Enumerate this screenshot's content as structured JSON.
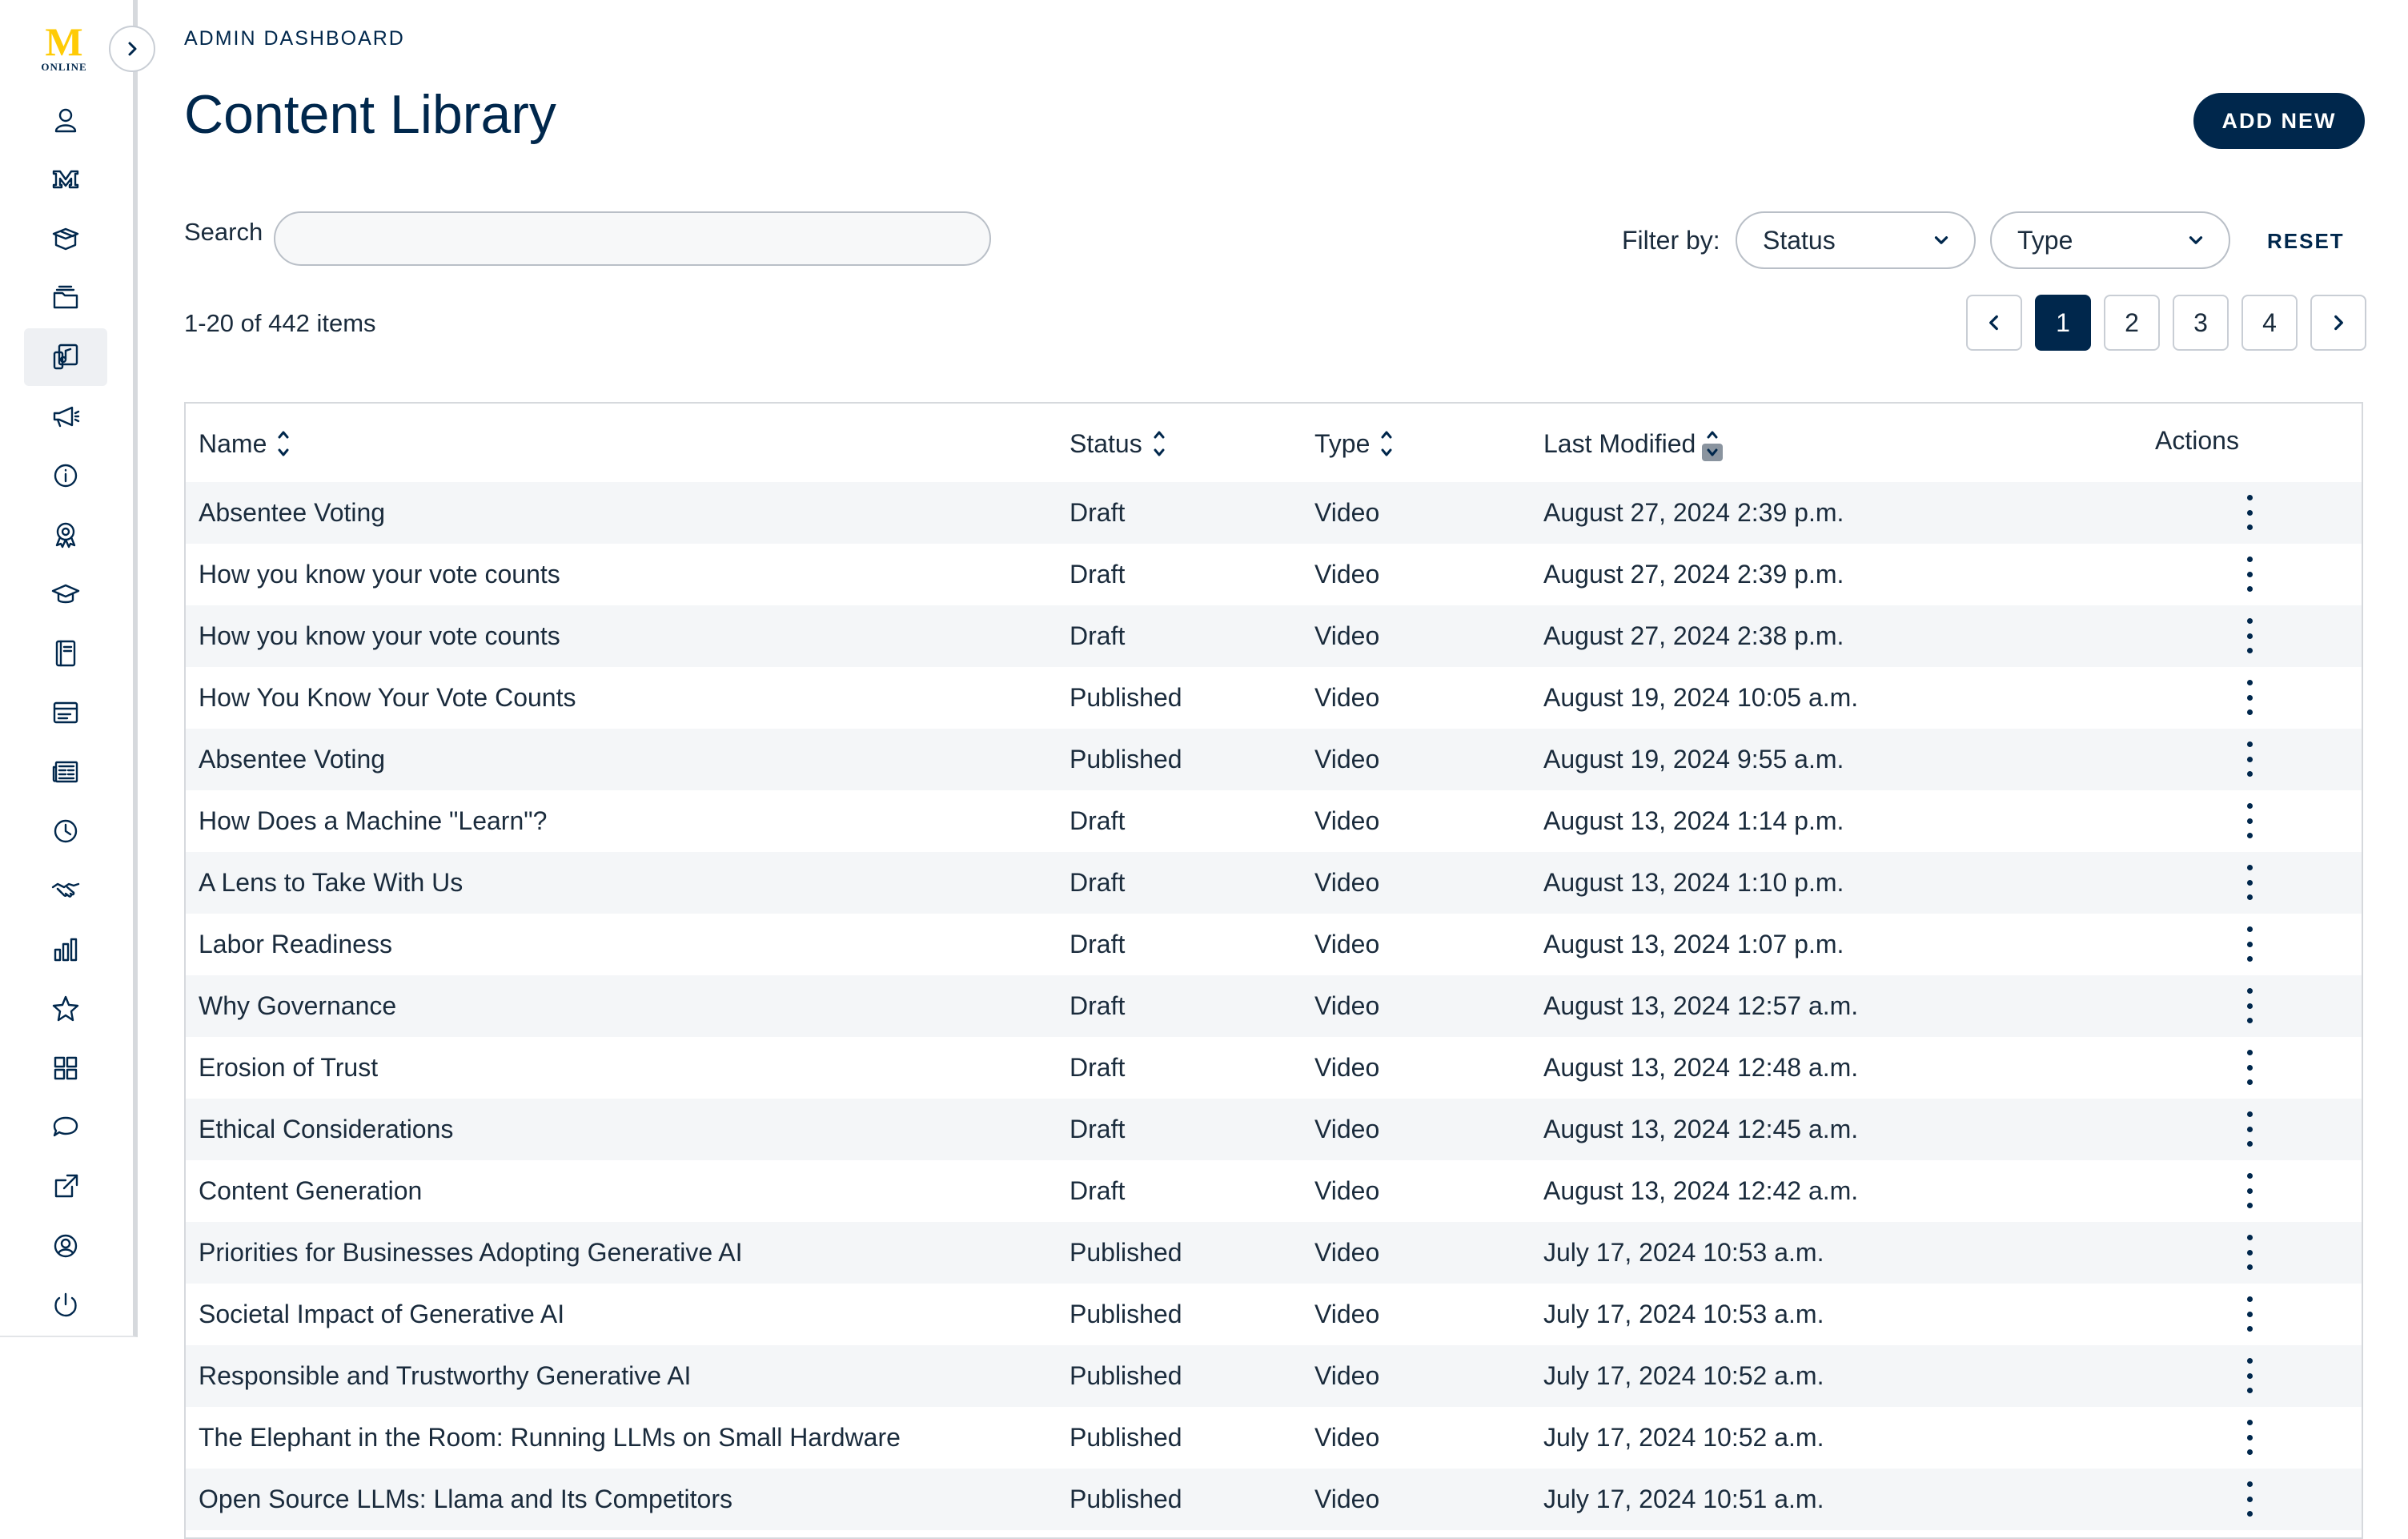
{
  "logo": {
    "mark": "M",
    "text": "ONLINE"
  },
  "sidebar": {
    "items": [
      {
        "icon": "user-icon"
      },
      {
        "icon": "block-m-icon"
      },
      {
        "icon": "package-icon"
      },
      {
        "icon": "folder-stack-icon"
      },
      {
        "icon": "media-library-icon",
        "active": true
      },
      {
        "icon": "megaphone-icon"
      },
      {
        "icon": "info-icon"
      },
      {
        "icon": "badge-icon"
      },
      {
        "icon": "graduation-cap-icon"
      },
      {
        "icon": "book-icon"
      },
      {
        "icon": "card-icon"
      },
      {
        "icon": "newspaper-icon"
      },
      {
        "icon": "clock-icon"
      },
      {
        "icon": "handshake-icon"
      },
      {
        "icon": "bar-chart-icon"
      },
      {
        "icon": "star-icon"
      },
      {
        "icon": "grid-icon"
      },
      {
        "icon": "chat-icon"
      },
      {
        "icon": "external-link-icon"
      },
      {
        "icon": "account-circle-icon"
      },
      {
        "icon": "power-icon"
      }
    ]
  },
  "header": {
    "eyebrow": "ADMIN DASHBOARD",
    "title": "Content Library",
    "add_new_label": "ADD NEW"
  },
  "search": {
    "label": "Search",
    "value": ""
  },
  "filters": {
    "label": "Filter by:",
    "status": "Status",
    "type": "Type",
    "reset_label": "RESET"
  },
  "summary": {
    "count_text": "1-20 of 442 items"
  },
  "pagination": {
    "pages": [
      "1",
      "2",
      "3",
      "4"
    ],
    "current": "1"
  },
  "table": {
    "headers": {
      "name": "Name",
      "status": "Status",
      "type": "Type",
      "modified": "Last Modified",
      "actions": "Actions"
    },
    "rows": [
      {
        "name": "Absentee Voting",
        "status": "Draft",
        "type": "Video",
        "modified": "August 27, 2024 2:39 p.m."
      },
      {
        "name": "How you know your vote counts",
        "status": "Draft",
        "type": "Video",
        "modified": "August 27, 2024 2:39 p.m."
      },
      {
        "name": "How you know your vote counts",
        "status": "Draft",
        "type": "Video",
        "modified": "August 27, 2024 2:38 p.m."
      },
      {
        "name": "How You Know Your Vote Counts",
        "status": "Published",
        "type": "Video",
        "modified": "August 19, 2024 10:05 a.m."
      },
      {
        "name": "Absentee Voting",
        "status": "Published",
        "type": "Video",
        "modified": "August 19, 2024 9:55 a.m."
      },
      {
        "name": "How Does a Machine \"Learn\"?",
        "status": "Draft",
        "type": "Video",
        "modified": "August 13, 2024 1:14 p.m."
      },
      {
        "name": "A Lens to Take With Us",
        "status": "Draft",
        "type": "Video",
        "modified": "August 13, 2024 1:10 p.m."
      },
      {
        "name": "Labor Readiness",
        "status": "Draft",
        "type": "Video",
        "modified": "August 13, 2024 1:07 p.m."
      },
      {
        "name": "Why Governance",
        "status": "Draft",
        "type": "Video",
        "modified": "August 13, 2024 12:57 a.m."
      },
      {
        "name": "Erosion of Trust",
        "status": "Draft",
        "type": "Video",
        "modified": "August 13, 2024 12:48 a.m."
      },
      {
        "name": "Ethical Considerations",
        "status": "Draft",
        "type": "Video",
        "modified": "August 13, 2024 12:45 a.m."
      },
      {
        "name": "Content Generation",
        "status": "Draft",
        "type": "Video",
        "modified": "August 13, 2024 12:42 a.m."
      },
      {
        "name": "Priorities for Businesses Adopting Generative AI",
        "status": "Published",
        "type": "Video",
        "modified": "July 17, 2024 10:53 a.m."
      },
      {
        "name": "Societal Impact of Generative AI",
        "status": "Published",
        "type": "Video",
        "modified": "July 17, 2024 10:53 a.m."
      },
      {
        "name": "Responsible and Trustworthy Generative AI",
        "status": "Published",
        "type": "Video",
        "modified": "July 17, 2024 10:52 a.m."
      },
      {
        "name": "The Elephant in the Room: Running LLMs on Small Hardware",
        "status": "Published",
        "type": "Video",
        "modified": "July 17, 2024 10:52 a.m."
      },
      {
        "name": "Open Source LLMs: Llama and Its Competitors",
        "status": "Published",
        "type": "Video",
        "modified": "July 17, 2024 10:51 a.m."
      }
    ]
  },
  "colors": {
    "brand_navy": "#00274c",
    "maize": "#ffcb05"
  }
}
